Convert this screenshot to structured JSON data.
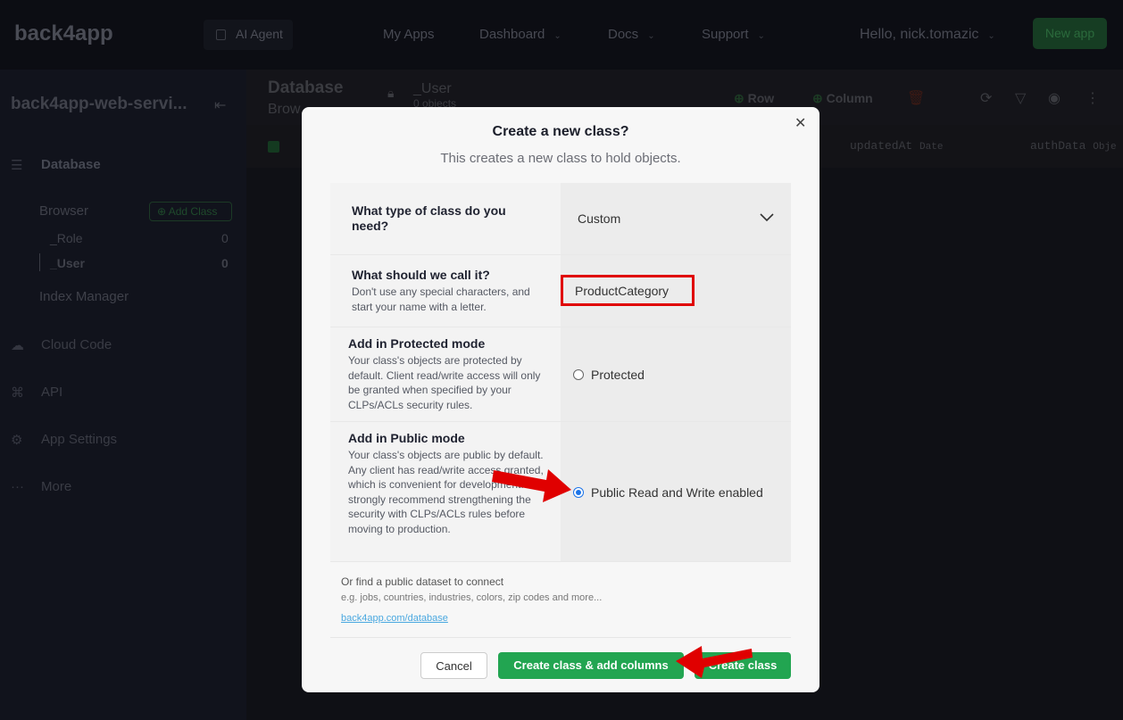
{
  "topbar": {
    "logo": "back4app",
    "ai_agent": "AI Agent",
    "nav": [
      "My Apps",
      "Dashboard",
      "Docs",
      "Support"
    ],
    "user": "Hello, nick.tomazic",
    "new_app": "New app"
  },
  "sidebar": {
    "app_name": "back4app-web-servi...",
    "database": "Database",
    "browser": "Browser",
    "add_class": "Add Class",
    "classes": [
      {
        "name": "_Role",
        "count": "0"
      },
      {
        "name": "_User",
        "count": "0"
      }
    ],
    "index_manager": "Index Manager",
    "items": [
      "Cloud Code",
      "API",
      "App Settings",
      "More"
    ]
  },
  "main": {
    "title": "Database",
    "subtitle": "Brow",
    "class_name": "_User",
    "class_sub": "0 objects",
    "row": "Row",
    "column": "Column",
    "columns": [
      {
        "name": "updatedAt",
        "type": "Date"
      },
      {
        "name": "authData",
        "type": "Obje"
      }
    ]
  },
  "modal": {
    "title": "Create a new class?",
    "subtitle": "This creates a new class to hold objects.",
    "type_label": "What type of class do you need?",
    "type_value": "Custom",
    "name_label": "What should we call it?",
    "name_desc": "Don't use any special characters, and start your name with a letter.",
    "name_value": "ProductCategory",
    "protected_label": "Add in Protected mode",
    "protected_desc": "Your class's objects are protected by default. Client read/write access will only be granted when specified by your CLPs/ACLs security rules.",
    "protected_option": "Protected",
    "public_label": "Add in Public mode",
    "public_desc": "Your class's objects are public by default. Any client has read/write access granted, which is convenient for development. We strongly recommend strengthening the security with CLPs/ACLs rules before moving to production.",
    "public_option": "Public Read and Write enabled",
    "dataset_title": "Or find a public dataset to connect",
    "dataset_desc": "e.g. jobs, countries, industries, colors, zip codes and more...",
    "dataset_link": "back4app.com/database",
    "cancel": "Cancel",
    "create_add": "Create class & add columns",
    "create": "Create class",
    "selected_mode": "public"
  },
  "colors": {
    "accent_green": "#22a551",
    "annotation_red": "#e00000",
    "radio_blue": "#1a73e8"
  }
}
